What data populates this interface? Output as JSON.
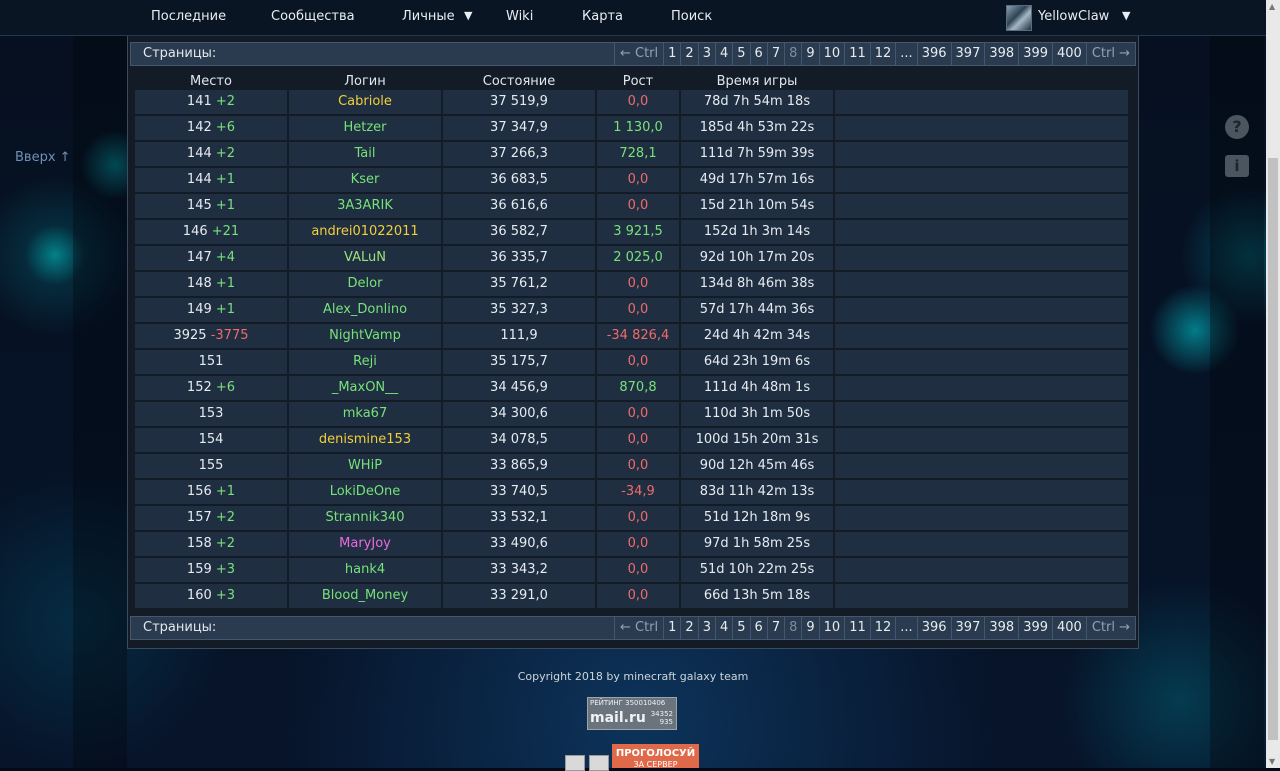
{
  "nav": {
    "items": [
      "Последние",
      "Сообщества",
      "Личные",
      "Wiki",
      "Карта",
      "Поиск"
    ],
    "username": "YellowClaw"
  },
  "side": {
    "up_link": "Вверх ↑",
    "help_icon": "?",
    "info_icon": "i"
  },
  "pager": {
    "label": "Страницы:",
    "prev": "← Ctrl",
    "next": "Ctrl →",
    "pages": [
      "1",
      "2",
      "3",
      "4",
      "5",
      "6",
      "7",
      "8",
      "9",
      "10",
      "11",
      "12",
      "...",
      "396",
      "397",
      "398",
      "399",
      "400"
    ],
    "current": "8"
  },
  "table": {
    "headers": [
      "Место",
      "Логин",
      "Состояние",
      "Рост",
      "Время игры"
    ],
    "rows": [
      {
        "place": "141",
        "change": "+2",
        "login": "Cabriole",
        "login_color": "yellow",
        "state": "37 519,9",
        "growth": "0,0",
        "time": "78d 7h 54m 18s"
      },
      {
        "place": "142",
        "change": "+6",
        "login": "Hetzer",
        "login_color": "green",
        "state": "37 347,9",
        "growth": "1 130,0",
        "time": "185d 4h 53m 22s"
      },
      {
        "place": "144",
        "change": "+2",
        "login": "Tail",
        "login_color": "green",
        "state": "37 266,3",
        "growth": "728,1",
        "time": "111d 7h 59m 39s"
      },
      {
        "place": "144",
        "change": "+1",
        "login": "Kser",
        "login_color": "green",
        "state": "36 683,5",
        "growth": "0,0",
        "time": "49d 17h 57m 16s"
      },
      {
        "place": "145",
        "change": "+1",
        "login": "3A3ARIK",
        "login_color": "green",
        "state": "36 616,6",
        "growth": "0,0",
        "time": "15d 21h 10m 54s"
      },
      {
        "place": "146",
        "change": "+21",
        "login": "andrei01022011",
        "login_color": "yellow",
        "state": "36 582,7",
        "growth": "3 921,5",
        "time": "152d 1h 3m 14s"
      },
      {
        "place": "147",
        "change": "+4",
        "login": "VALuN",
        "login_color": "lgreen",
        "state": "36 335,7",
        "growth": "2 025,0",
        "time": "92d 10h 17m 20s"
      },
      {
        "place": "148",
        "change": "+1",
        "login": "Delor",
        "login_color": "green",
        "state": "35 761,2",
        "growth": "0,0",
        "time": "134d 8h 46m 38s"
      },
      {
        "place": "149",
        "change": "+1",
        "login": "Alex_Donlino",
        "login_color": "green",
        "state": "35 327,3",
        "growth": "0,0",
        "time": "57d 17h 44m 36s"
      },
      {
        "place": "3925",
        "change": "-3775",
        "login": "NightVamp",
        "login_color": "green",
        "state": "111,9",
        "growth": "-34 826,4",
        "time": "24d 4h 42m 34s"
      },
      {
        "place": "151",
        "change": "",
        "login": "Reji",
        "login_color": "green",
        "state": "35 175,7",
        "growth": "0,0",
        "time": "64d 23h 19m 6s"
      },
      {
        "place": "152",
        "change": "+6",
        "login": "_MaxON__",
        "login_color": "green",
        "state": "34 456,9",
        "growth": "870,8",
        "time": "111d 4h 48m 1s"
      },
      {
        "place": "153",
        "change": "",
        "login": "mka67",
        "login_color": "green",
        "state": "34 300,6",
        "growth": "0,0",
        "time": "110d 3h 1m 50s"
      },
      {
        "place": "154",
        "change": "",
        "login": "denismine153",
        "login_color": "yellow",
        "state": "34 078,5",
        "growth": "0,0",
        "time": "100d 15h 20m 31s"
      },
      {
        "place": "155",
        "change": "",
        "login": "WHiP",
        "login_color": "green",
        "state": "33 865,9",
        "growth": "0,0",
        "time": "90d 12h 45m 46s"
      },
      {
        "place": "156",
        "change": "+1",
        "login": "LokiDeOne",
        "login_color": "green",
        "state": "33 740,5",
        "growth": "-34,9",
        "time": "83d 11h 42m 13s"
      },
      {
        "place": "157",
        "change": "+2",
        "login": "Strannik340",
        "login_color": "green",
        "state": "33 532,1",
        "growth": "0,0",
        "time": "51d 12h 18m 9s"
      },
      {
        "place": "158",
        "change": "+2",
        "login": "MaryJoy",
        "login_color": "magenta",
        "state": "33 490,6",
        "growth": "0,0",
        "time": "97d 1h 58m 25s"
      },
      {
        "place": "159",
        "change": "+3",
        "login": "hank4",
        "login_color": "green",
        "state": "33 343,2",
        "growth": "0,0",
        "time": "51d 10h 22m 25s"
      },
      {
        "place": "160",
        "change": "+3",
        "login": "Blood_Money",
        "login_color": "green",
        "state": "33 291,0",
        "growth": "0,0",
        "time": "66d 13h 5m 18s"
      }
    ]
  },
  "footer": {
    "copyright": "Copyright 2018 by minecraft galaxy team",
    "counter_title": "РЕЙТИНГ 350010406",
    "counter_logo": "mail.ru",
    "counter_n1": "34352",
    "counter_n2": "935",
    "vote_line1": "ПРОГОЛОСУЙ",
    "vote_line2": "ЗА СЕРВЕР"
  }
}
